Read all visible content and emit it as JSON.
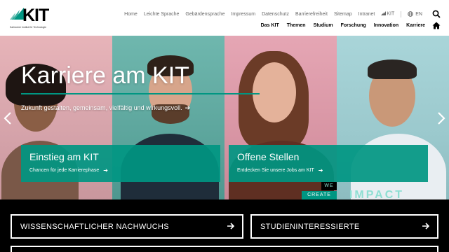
{
  "logo": {
    "text": "KIT",
    "subtitle": "Karlsruher Institut für Technologie"
  },
  "meta_nav": [
    "Home",
    "Leichte Sprache",
    "Gebärdensprache",
    "Impressum",
    "Datenschutz",
    "Barrierefreiheit",
    "Sitemap",
    "Intranet",
    "KIT"
  ],
  "lang": "EN",
  "main_nav": [
    "Das KIT",
    "Themen",
    "Studium",
    "Forschung",
    "Innovation",
    "Karriere"
  ],
  "hero": {
    "title": "Karriere am KIT",
    "subtitle": "Zukunft gestalten, gemeinsam, vielfältig und wirkungsvoll."
  },
  "tiles": [
    {
      "title": "Einstieg am KIT",
      "subtitle": "Chancen für jede Karrierephase"
    },
    {
      "title": "Offene Stellen",
      "subtitle": "Entdecken Sie unsere Jobs am KIT"
    }
  ],
  "campaign": {
    "we": "WE",
    "create": "CREATE",
    "impact": "IMPACT"
  },
  "cta": [
    "WISSENSCHAFTLICHER NACHWUCHS",
    "STUDIENINTERESSIERTE"
  ],
  "colors": {
    "accent": "#009682",
    "text": "#000000",
    "meta": "#666666"
  },
  "icons": [
    "globe-icon",
    "search-icon",
    "home-icon",
    "chevron-left-icon",
    "chevron-right-icon",
    "arrow-right-icon"
  ]
}
